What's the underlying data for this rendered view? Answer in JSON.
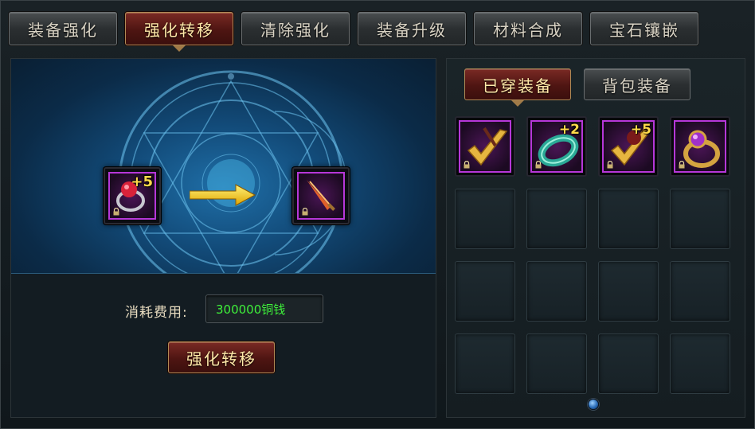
{
  "tabs": [
    {
      "label": "装备强化",
      "active": false
    },
    {
      "label": "强化转移",
      "active": true
    },
    {
      "label": "清除强化",
      "active": false
    },
    {
      "label": "装备升级",
      "active": false
    },
    {
      "label": "材料合成",
      "active": false
    },
    {
      "label": "宝石镶嵌",
      "active": false
    }
  ],
  "transfer": {
    "source_item": {
      "icon": "ruby-ring-icon",
      "enhance": "+5",
      "locked": true
    },
    "target_item": {
      "icon": "flame-dagger-icon",
      "enhance": "",
      "locked": true
    },
    "arrow_icon": "yellow-arrow-right-icon",
    "cost_label": "消耗费用:",
    "cost_value": "300000铜钱",
    "button_label": "强化转移"
  },
  "equipment": {
    "sub_tabs": [
      {
        "label": "已穿装备",
        "active": true
      },
      {
        "label": "背包装备",
        "active": false
      }
    ],
    "items": [
      {
        "icon": "golden-claw-weapon-icon",
        "enhance": "",
        "locked": true
      },
      {
        "icon": "jade-bracelet-icon",
        "enhance": "+2",
        "locked": true
      },
      {
        "icon": "golden-claw-weapon-icon",
        "enhance": "+5",
        "locked": true
      },
      {
        "icon": "amethyst-ring-icon",
        "enhance": "",
        "locked": true
      }
    ],
    "total_slots": 16
  },
  "colors": {
    "accent_purple": "#b637d8",
    "cost_green": "#3ef03a",
    "enhance_gold": "#ffd84a",
    "active_tab_red": "#4e1512"
  }
}
